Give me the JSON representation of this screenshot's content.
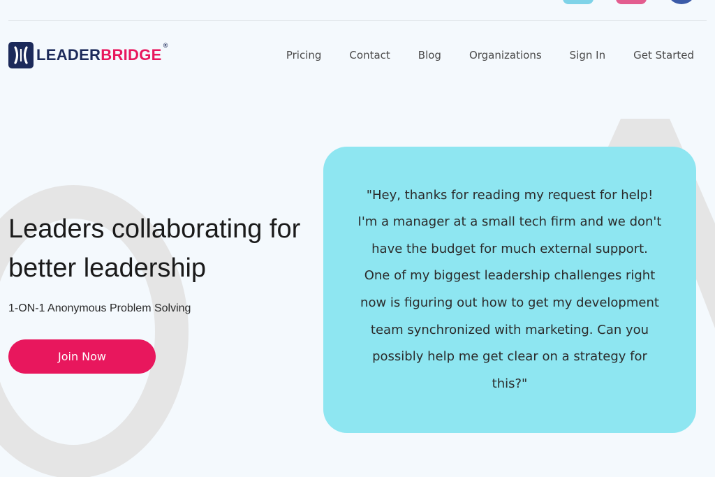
{
  "brand": {
    "name_part1": "LEADER",
    "name_part2": "BRIDGE",
    "trademark": "®",
    "colors": {
      "navy": "#1c2a5a",
      "pink": "#e8175d",
      "quote_bg": "#8ee6f1"
    }
  },
  "social": {
    "icons": [
      "twitter-icon",
      "instagram-icon",
      "facebook-icon"
    ]
  },
  "nav": {
    "items": [
      {
        "label": "Pricing"
      },
      {
        "label": "Contact"
      },
      {
        "label": "Blog"
      },
      {
        "label": "Organizations"
      },
      {
        "label": "Sign In"
      },
      {
        "label": "Get Started"
      }
    ]
  },
  "hero": {
    "title": "Leaders collaborating for better leadership",
    "subtitle": "1-ON-1 Anonymous Problem Solving",
    "cta_label": "Join Now"
  },
  "quote": {
    "text": "\"Hey, thanks for reading my request for help! I'm a manager at a small tech firm and we don't have the budget for much external support. One of my biggest leadership challenges right now is figuring out how to get my development team synchronized with marketing. Can you possibly help me get clear on a strategy for this?\""
  }
}
